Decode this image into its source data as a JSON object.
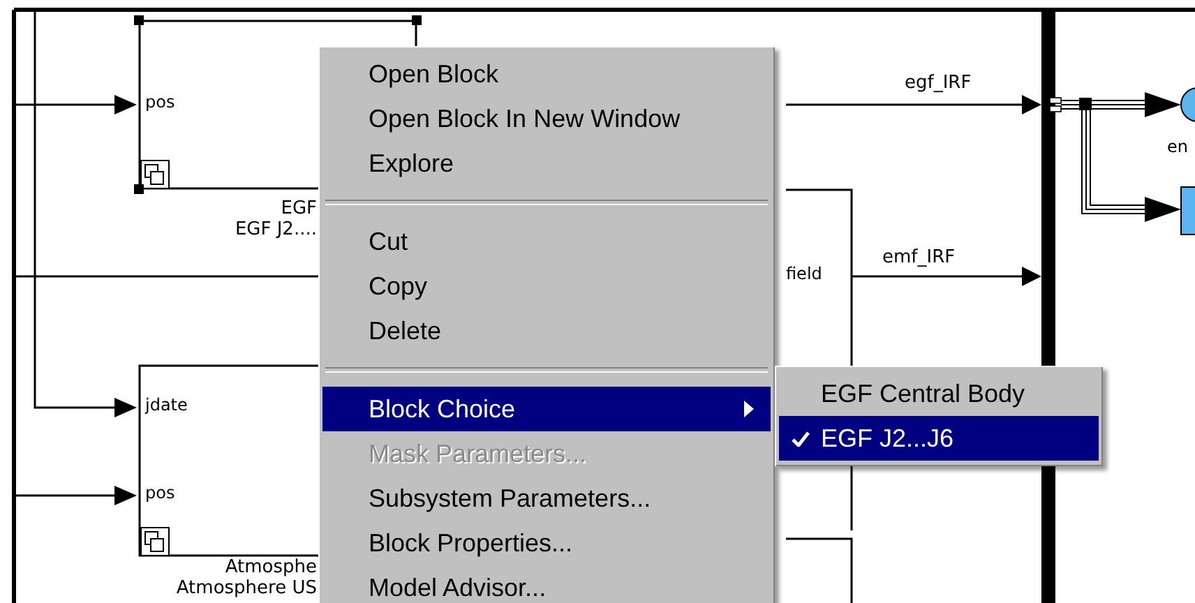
{
  "diagram": {
    "blocks": [
      {
        "selected": true,
        "ports": [
          "pos"
        ],
        "name_lines": [
          "EGF",
          "EGF J2...."
        ]
      },
      {
        "selected": false,
        "ports": [
          "jdate",
          "pos"
        ],
        "name_lines": [
          "Atmosphe",
          "Atmosphere US"
        ]
      }
    ],
    "signals": [
      {
        "label": "egf_IRF"
      },
      {
        "label": "emf_IRF"
      }
    ],
    "port_labels": [
      "field",
      "en"
    ]
  },
  "context_menu": {
    "items": [
      {
        "kind": "item",
        "label": "Open Block",
        "disabled": false,
        "selected": false,
        "submenu": false
      },
      {
        "kind": "item",
        "label": "Open Block In New Window",
        "disabled": false,
        "selected": false,
        "submenu": false
      },
      {
        "kind": "item",
        "label": "Explore",
        "disabled": false,
        "selected": false,
        "submenu": false
      },
      {
        "kind": "separator"
      },
      {
        "kind": "item",
        "label": "Cut",
        "disabled": false,
        "selected": false,
        "submenu": false
      },
      {
        "kind": "item",
        "label": "Copy",
        "disabled": false,
        "selected": false,
        "submenu": false
      },
      {
        "kind": "item",
        "label": "Delete",
        "disabled": false,
        "selected": false,
        "submenu": false
      },
      {
        "kind": "separator"
      },
      {
        "kind": "item",
        "label": "Block Choice",
        "disabled": false,
        "selected": true,
        "submenu": true
      },
      {
        "kind": "item",
        "label": "Mask Parameters...",
        "disabled": true,
        "selected": false,
        "submenu": false
      },
      {
        "kind": "item",
        "label": "Subsystem Parameters...",
        "disabled": false,
        "selected": false,
        "submenu": false
      },
      {
        "kind": "item",
        "label": "Block Properties...",
        "disabled": false,
        "selected": false,
        "submenu": false
      },
      {
        "kind": "item",
        "label": "Model Advisor...",
        "disabled": false,
        "selected": false,
        "submenu": false
      }
    ]
  },
  "submenu": {
    "items": [
      {
        "label": "EGF Central Body",
        "checked": false,
        "selected": false
      },
      {
        "label": "EGF J2...J6",
        "checked": true,
        "selected": true
      }
    ]
  }
}
